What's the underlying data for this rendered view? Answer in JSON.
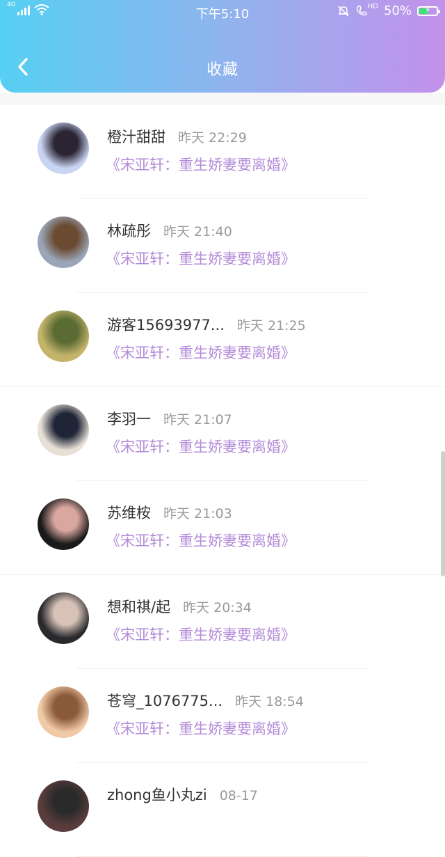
{
  "status_bar": {
    "network": "4G",
    "time": "下午5:10",
    "hd_label": "HD",
    "battery": "50%"
  },
  "header": {
    "title": "收藏"
  },
  "favorites": [
    {
      "name": "橙汁甜甜",
      "time": "昨天 22:29",
      "book": "《宋亚轩：重生娇妻要离婚》",
      "avatar_colors": [
        "#c9d4f2",
        "#2a2433"
      ]
    },
    {
      "name": "林疏彤",
      "time": "昨天 21:40",
      "book": "《宋亚轩：重生娇妻要离婚》",
      "avatar_colors": [
        "#9aa6b8",
        "#6b4a32"
      ]
    },
    {
      "name": "游客15693977...",
      "time": "昨天 21:25",
      "book": "《宋亚轩：重生娇妻要离婚》",
      "avatar_colors": [
        "#c4b46a",
        "#5a6b34"
      ]
    },
    {
      "name": "李羽一",
      "time": "昨天 21:07",
      "book": "《宋亚轩：重生娇妻要离婚》",
      "avatar_colors": [
        "#e6e0d6",
        "#1f2436"
      ]
    },
    {
      "name": "苏维桉",
      "time": "昨天 21:03",
      "book": "《宋亚轩：重生娇妻要离婚》",
      "avatar_colors": [
        "#1a1a1a",
        "#d9a6a0"
      ]
    },
    {
      "name": "想和祺/起",
      "time": "昨天 20:34",
      "book": "《宋亚轩：重生娇妻要离婚》",
      "avatar_colors": [
        "#2a2a2e",
        "#d8c2b8"
      ]
    },
    {
      "name": "苍穹_1076775...",
      "time": "昨天 18:54",
      "book": "《宋亚轩：重生娇妻要离婚》",
      "avatar_colors": [
        "#f0c9a6",
        "#8a5a3a"
      ]
    },
    {
      "name": "zhong鱼小丸zi",
      "time": "08-17",
      "book": "",
      "avatar_colors": [
        "#5a3c3c",
        "#2a2a2a"
      ]
    }
  ],
  "colors": {
    "header_gradient_start": "#56d0f2",
    "header_gradient_end": "#c391ea",
    "book_title": "#b38ad8",
    "name": "#333333",
    "time": "#9a9a9a"
  }
}
